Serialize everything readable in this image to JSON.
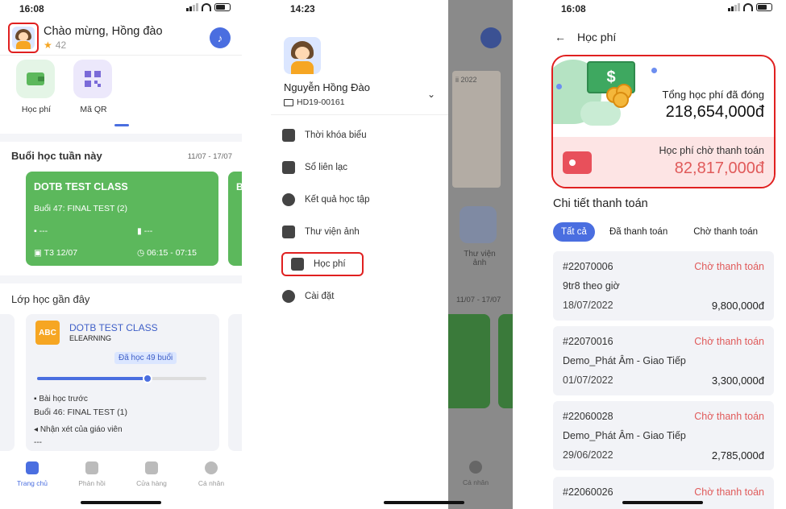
{
  "home": {
    "status_time": "16:08",
    "greeting": "Chào mừng, Hồng đào",
    "star_count": "42",
    "quick_actions": [
      {
        "label": "Học phí",
        "icon": "wallet-icon"
      },
      {
        "label": "Mã QR",
        "icon": "qr-code-icon"
      }
    ],
    "week_section": {
      "title": "Buổi học tuần này",
      "range": "11/07 - 17/07",
      "card": {
        "class_name": "DOTB TEST CLASS",
        "session": "Buổi 47: FINAL TEST (2)",
        "teacher": "---",
        "room": "---",
        "date": "T3 12/07",
        "time": "06:15 - 07:15"
      },
      "next_card_initial": "B"
    },
    "recent_section": {
      "title": "Lớp học gần đây",
      "card": {
        "class_name": "DOTB TEST CLASS",
        "type": "ELEARNING",
        "progress_label": "Đã học 49 buổi",
        "progress_fraction": 0.65,
        "prev_lesson_label": "Bài học trước",
        "prev_lesson": "Buổi 46: FINAL TEST (1)",
        "teacher_comment_label": "Nhận xét của giáo viên",
        "teacher_comment": "---"
      }
    },
    "tabs": [
      {
        "label": "Trang chủ",
        "active": true
      },
      {
        "label": "Phản hồi",
        "active": false
      },
      {
        "label": "Cửa hàng",
        "active": false
      },
      {
        "label": "Cá nhân",
        "active": false
      }
    ]
  },
  "drawer": {
    "status_time": "14:23",
    "student_name": "Nguyễn Hồng Đào",
    "student_id": "HD19-00161",
    "menu": [
      {
        "label": "Thời khóa biểu",
        "icon": "calendar-icon"
      },
      {
        "label": "Sổ liên lạc",
        "icon": "chart-icon"
      },
      {
        "label": "Kết quả học tập",
        "icon": "results-icon"
      },
      {
        "label": "Thư viện ảnh",
        "icon": "gallery-icon"
      },
      {
        "label": "Học phí",
        "icon": "wallet-icon"
      },
      {
        "label": "Cài đặt",
        "icon": "gear-icon"
      }
    ],
    "background": {
      "paper_title": "ii 2022",
      "library_label": "Thư viện ảnh",
      "range": "11/07 - 17/07",
      "tab_label": "Cá nhân"
    }
  },
  "fees": {
    "status_time": "16:08",
    "title": "Học phí",
    "total_paid_label": "Tổng học phí đã đóng",
    "total_paid_value": "218,654,000đ",
    "pending_label": "Học phí chờ thanh toán",
    "pending_value": "82,817,000đ",
    "detail_title": "Chi tiết thanh toán",
    "filters": [
      "Tất cả",
      "Đã thanh toán",
      "Chờ thanh toán"
    ],
    "payments": [
      {
        "code": "#22070006",
        "status": "Chờ thanh toán",
        "name": "9tr8 theo giờ",
        "date": "18/07/2022",
        "amount": "9,800,000đ"
      },
      {
        "code": "#22070016",
        "status": "Chờ thanh toán",
        "name": "Demo_Phát Âm - Giao Tiếp",
        "date": "01/07/2022",
        "amount": "3,300,000đ"
      },
      {
        "code": "#22060028",
        "status": "Chờ thanh toán",
        "name": "Demo_Phát Âm - Giao Tiếp",
        "date": "29/06/2022",
        "amount": "2,785,000đ"
      },
      {
        "code": "#22060026",
        "status": "Chờ thanh toán",
        "name": "",
        "date": "",
        "amount": ""
      }
    ]
  },
  "colors": {
    "accent": "#4a6ee0",
    "highlight": "#e02020",
    "green": "#5cb85c",
    "pending": "#e05a5a"
  }
}
